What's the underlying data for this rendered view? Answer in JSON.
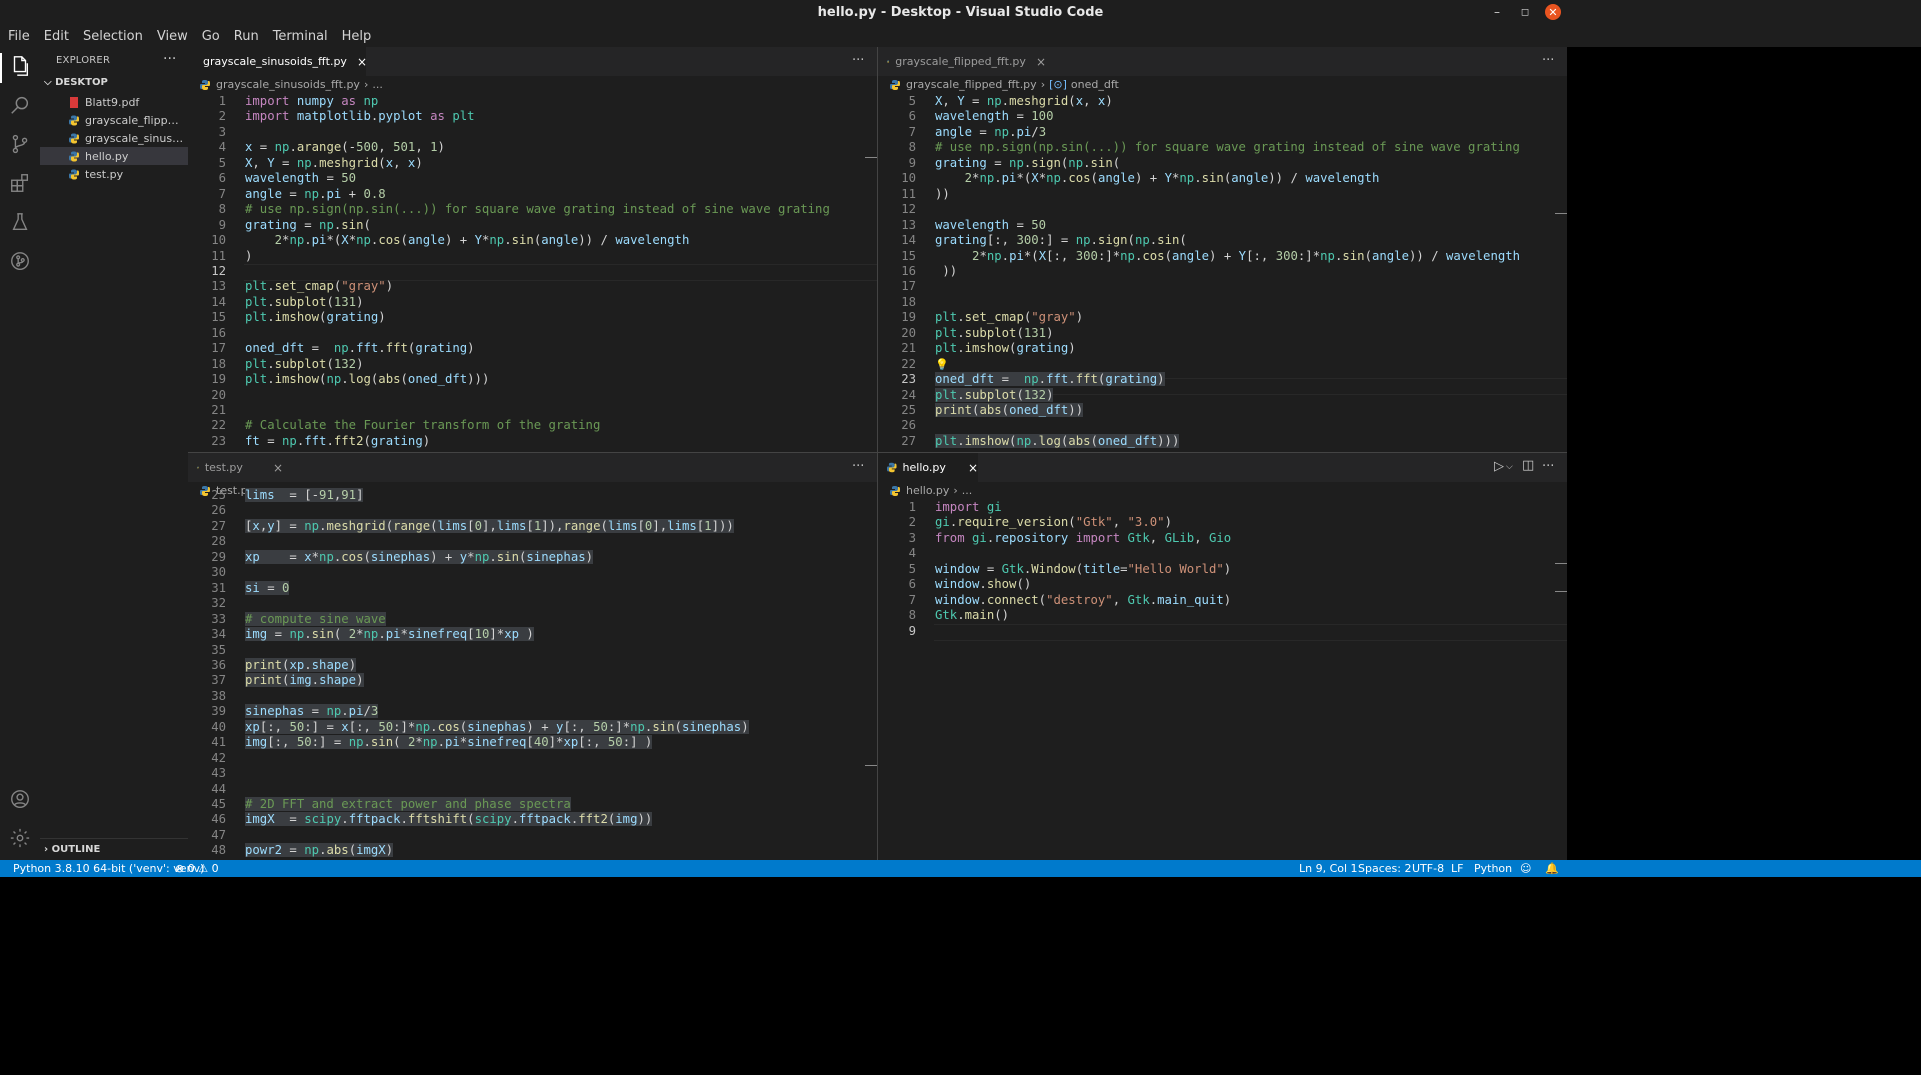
{
  "window": {
    "title": "hello.py - Desktop - Visual Studio Code",
    "minimize": "–",
    "maximize": "◻",
    "close": "✕"
  },
  "menu": [
    "File",
    "Edit",
    "Selection",
    "View",
    "Go",
    "Run",
    "Terminal",
    "Help"
  ],
  "explorer": {
    "header": "EXPLORER",
    "more": "···",
    "section": "DESKTOP",
    "files": [
      {
        "name": "Blatt9.pdf",
        "type": "pdf"
      },
      {
        "name": "grayscale_flipped_fft.py",
        "type": "py"
      },
      {
        "name": "grayscale_sinusoids_fft.py",
        "type": "py"
      },
      {
        "name": "hello.py",
        "type": "py"
      },
      {
        "name": "test.py",
        "type": "py"
      }
    ],
    "outline": "OUTLINE"
  },
  "panes": {
    "top_left": {
      "tab": "grayscale_sinusoids_fft.py",
      "crumb_file": "grayscale_sinusoids_fft.py",
      "crumb_rest": "...",
      "current_line": 12,
      "lines": [
        {
          "n": 1,
          "t": "import numpy as np"
        },
        {
          "n": 2,
          "t": "import matplotlib.pyplot as plt"
        },
        {
          "n": 3,
          "t": ""
        },
        {
          "n": 4,
          "t": "x = np.arange(-500, 501, 1)"
        },
        {
          "n": 5,
          "t": "X, Y = np.meshgrid(x, x)"
        },
        {
          "n": 6,
          "t": "wavelength = 50"
        },
        {
          "n": 7,
          "t": "angle = np.pi + 0.8"
        },
        {
          "n": 8,
          "t": "# use np.sign(np.sin(...)) for square wave grating instead of sine wave grating"
        },
        {
          "n": 9,
          "t": "grating = np.sin("
        },
        {
          "n": 10,
          "t": "    2*np.pi*(X*np.cos(angle) + Y*np.sin(angle)) / wavelength"
        },
        {
          "n": 11,
          "t": ")"
        },
        {
          "n": 12,
          "t": ""
        },
        {
          "n": 13,
          "t": "plt.set_cmap(\"gray\")"
        },
        {
          "n": 14,
          "t": "plt.subplot(131)"
        },
        {
          "n": 15,
          "t": "plt.imshow(grating)"
        },
        {
          "n": 16,
          "t": ""
        },
        {
          "n": 17,
          "t": "oned_dft =  np.fft.fft(grating)"
        },
        {
          "n": 18,
          "t": "plt.subplot(132)"
        },
        {
          "n": 19,
          "t": "plt.imshow(np.log(abs(oned_dft)))"
        },
        {
          "n": 20,
          "t": ""
        },
        {
          "n": 21,
          "t": ""
        },
        {
          "n": 22,
          "t": "# Calculate the Fourier transform of the grating"
        },
        {
          "n": 23,
          "t": "ft = np.fft.fft2(grating)"
        }
      ]
    },
    "top_right": {
      "tab": "grayscale_flipped_fft.py",
      "crumb_file": "grayscale_flipped_fft.py",
      "crumb_symbol": "oned_dft",
      "current_line": 23,
      "lines": [
        {
          "n": 5,
          "t": "X, Y = np.meshgrid(x, x)"
        },
        {
          "n": 6,
          "t": "wavelength = 100"
        },
        {
          "n": 7,
          "t": "angle = np.pi/3"
        },
        {
          "n": 8,
          "t": "# use np.sign(np.sin(...)) for square wave grating instead of sine wave grating"
        },
        {
          "n": 9,
          "t": "grating = np.sign(np.sin("
        },
        {
          "n": 10,
          "t": "    2*np.pi*(X*np.cos(angle) + Y*np.sin(angle)) / wavelength"
        },
        {
          "n": 11,
          "t": "))"
        },
        {
          "n": 12,
          "t": ""
        },
        {
          "n": 13,
          "t": "wavelength = 50"
        },
        {
          "n": 14,
          "t": "grating[:, 300:] = np.sign(np.sin("
        },
        {
          "n": 15,
          "t": "     2*np.pi*(X[:, 300:]*np.cos(angle) + Y[:, 300:]*np.sin(angle)) / wavelength"
        },
        {
          "n": 16,
          "t": " ))"
        },
        {
          "n": 17,
          "t": ""
        },
        {
          "n": 18,
          "t": ""
        },
        {
          "n": 19,
          "t": "plt.set_cmap(\"gray\")"
        },
        {
          "n": 20,
          "t": "plt.subplot(131)"
        },
        {
          "n": 21,
          "t": "plt.imshow(grating)"
        },
        {
          "n": 22,
          "t": "💡"
        },
        {
          "n": 23,
          "t": "oned_dft =  np.fft.fft(grating)"
        },
        {
          "n": 24,
          "t": "plt.subplot(132)"
        },
        {
          "n": 25,
          "t": "print(abs(oned_dft))"
        },
        {
          "n": 26,
          "t": ""
        },
        {
          "n": 27,
          "t": "plt.imshow(np.log(abs(oned_dft)))"
        }
      ]
    },
    "bottom_left": {
      "tab": "test.py",
      "crumb_file": "test.py",
      "crumb_rest": "...",
      "lines": [
        {
          "n": 25,
          "t": "lims  = [-91,91]"
        },
        {
          "n": 26,
          "t": ""
        },
        {
          "n": 27,
          "t": "[x,y] = np.meshgrid(range(lims[0],lims[1]),range(lims[0],lims[1]))"
        },
        {
          "n": 28,
          "t": ""
        },
        {
          "n": 29,
          "t": "xp    = x*np.cos(sinephas) + y*np.sin(sinephas)"
        },
        {
          "n": 30,
          "t": ""
        },
        {
          "n": 31,
          "t": "si = 0"
        },
        {
          "n": 32,
          "t": ""
        },
        {
          "n": 33,
          "t": "# compute sine wave"
        },
        {
          "n": 34,
          "t": "img = np.sin( 2*np.pi*sinefreq[10]*xp )"
        },
        {
          "n": 35,
          "t": ""
        },
        {
          "n": 36,
          "t": "print(xp.shape)"
        },
        {
          "n": 37,
          "t": "print(img.shape)"
        },
        {
          "n": 38,
          "t": ""
        },
        {
          "n": 39,
          "t": "sinephas = np.pi/3"
        },
        {
          "n": 40,
          "t": "xp[:, 50:] = x[:, 50:]*np.cos(sinephas) + y[:, 50:]*np.sin(sinephas)"
        },
        {
          "n": 41,
          "t": "img[:, 50:] = np.sin( 2*np.pi*sinefreq[40]*xp[:, 50:] )"
        },
        {
          "n": 42,
          "t": ""
        },
        {
          "n": 43,
          "t": ""
        },
        {
          "n": 44,
          "t": ""
        },
        {
          "n": 45,
          "t": "# 2D FFT and extract power and phase spectra"
        },
        {
          "n": 46,
          "t": "imgX  = scipy.fftpack.fftshift(scipy.fftpack.fft2(img))"
        },
        {
          "n": 47,
          "t": ""
        },
        {
          "n": 48,
          "t": "powr2 = np.abs(imgX)"
        }
      ]
    },
    "bottom_right": {
      "tab": "hello.py",
      "crumb_file": "hello.py",
      "crumb_rest": "...",
      "current_line": 9,
      "run_icon": "▷",
      "lines": [
        {
          "n": 1,
          "t": "import gi"
        },
        {
          "n": 2,
          "t": "gi.require_version(\"Gtk\", \"3.0\")"
        },
        {
          "n": 3,
          "t": "from gi.repository import Gtk, GLib, Gio"
        },
        {
          "n": 4,
          "t": ""
        },
        {
          "n": 5,
          "t": "window = Gtk.Window(title=\"Hello World\")"
        },
        {
          "n": 6,
          "t": "window.show()"
        },
        {
          "n": 7,
          "t": "window.connect(\"destroy\", Gtk.main_quit)"
        },
        {
          "n": 8,
          "t": "Gtk.main()"
        },
        {
          "n": 9,
          "t": ""
        }
      ]
    }
  },
  "statusbar": {
    "interpreter": "Python 3.8.10 64-bit ('venv': venv)",
    "problems": "⊗ 0 ⚠ 0",
    "position": "Ln 9, Col 1",
    "spaces": "Spaces: 2",
    "encoding": "UTF-8",
    "eol": "LF",
    "language": "Python"
  },
  "colors": {
    "accent": "#007acc",
    "editor_bg": "#1e1e1e",
    "tab_bar": "#252526"
  },
  "icons": [
    "files-icon",
    "search-icon",
    "source-control-icon",
    "extensions-icon",
    "testing-icon",
    "git-graph-icon",
    "account-icon",
    "settings-gear-icon",
    "python-file-icon",
    "pdf-file-icon",
    "close-icon",
    "run-icon",
    "split-editor-icon",
    "more-actions-icon",
    "bell-icon",
    "feedback-icon",
    "lightbulb-icon"
  ]
}
